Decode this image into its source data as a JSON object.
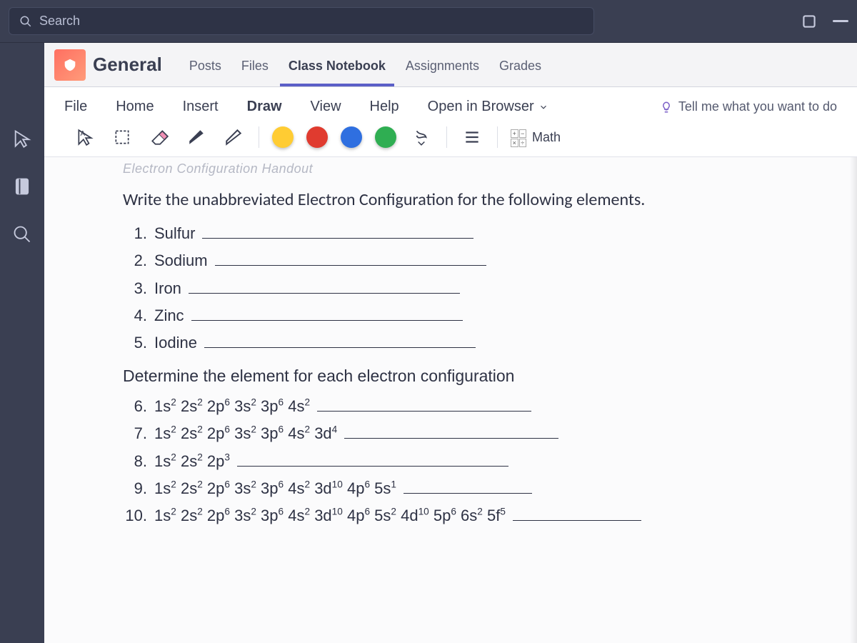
{
  "topbar": {
    "search_placeholder": "Search"
  },
  "channel": {
    "title": "General",
    "tabs": [
      "Posts",
      "Files",
      "Class Notebook",
      "Assignments",
      "Grades"
    ],
    "active_tab_index": 2
  },
  "menu": {
    "items": [
      "File",
      "Home",
      "Insert",
      "Draw",
      "View",
      "Help"
    ],
    "active_index": 3,
    "open_in_browser": "Open in Browser",
    "tell_me": "Tell me what you want to do"
  },
  "toolbar": {
    "colors": {
      "yellow": "#ffcc33",
      "red": "#e03b2f",
      "blue": "#2f6fe0",
      "green": "#2fae52"
    },
    "math_label": "Math"
  },
  "document": {
    "faded_title": "Electron Configuration Handout",
    "heading1": "Write the unabbreviated Electron Configuration for the following elements.",
    "part1": [
      {
        "num": "1.",
        "text": "Sulfur"
      },
      {
        "num": "2.",
        "text": "Sodium"
      },
      {
        "num": "3.",
        "text": "Iron"
      },
      {
        "num": "4.",
        "text": "Zinc"
      },
      {
        "num": "5.",
        "text": "Iodine"
      }
    ],
    "heading2": "Determine the element for each electron configuration",
    "part2": [
      {
        "num": "6.",
        "terms": [
          [
            "1s",
            "2"
          ],
          [
            "2s",
            "2"
          ],
          [
            "2p",
            "6"
          ],
          [
            "3s",
            "2"
          ],
          [
            "3p",
            "6"
          ],
          [
            "4s",
            "2"
          ]
        ]
      },
      {
        "num": "7.",
        "terms": [
          [
            "1s",
            "2"
          ],
          [
            "2s",
            "2"
          ],
          [
            "2p",
            "6"
          ],
          [
            "3s",
            "2"
          ],
          [
            "3p",
            "6"
          ],
          [
            "4s",
            "2"
          ],
          [
            "3d",
            "4"
          ]
        ]
      },
      {
        "num": "8.",
        "terms": [
          [
            "1s",
            "2"
          ],
          [
            "2s",
            "2"
          ],
          [
            "2p",
            "3"
          ]
        ]
      },
      {
        "num": "9.",
        "terms": [
          [
            "1s",
            "2"
          ],
          [
            "2s",
            "2"
          ],
          [
            "2p",
            "6"
          ],
          [
            "3s",
            "2"
          ],
          [
            "3p",
            "6"
          ],
          [
            "4s",
            "2"
          ],
          [
            "3d",
            "10"
          ],
          [
            "4p",
            "6"
          ],
          [
            "5s",
            "1"
          ]
        ]
      },
      {
        "num": "10.",
        "terms": [
          [
            "1s",
            "2"
          ],
          [
            "2s",
            "2"
          ],
          [
            "2p",
            "6"
          ],
          [
            "3s",
            "2"
          ],
          [
            "3p",
            "6"
          ],
          [
            "4s",
            "2"
          ],
          [
            "3d",
            "10"
          ],
          [
            "4p",
            "6"
          ],
          [
            "5s",
            "2"
          ],
          [
            "4d",
            "10"
          ],
          [
            "5p",
            "6"
          ],
          [
            "6s",
            "2"
          ],
          [
            "5f",
            "5"
          ]
        ]
      }
    ]
  }
}
